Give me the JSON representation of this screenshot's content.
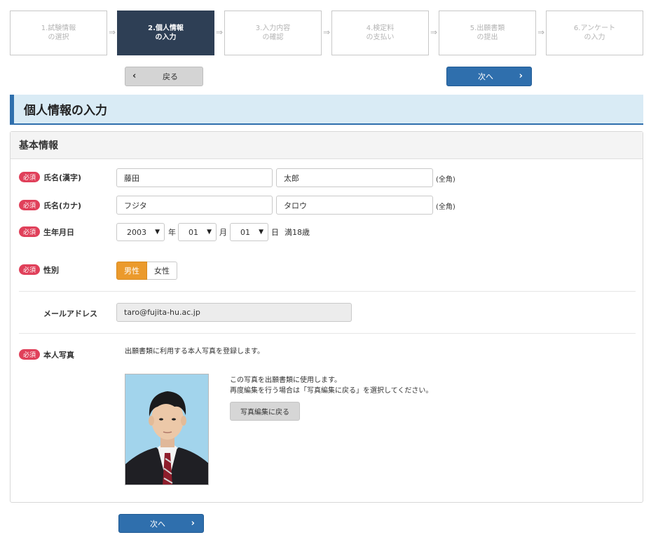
{
  "steps": [
    {
      "label": "1.試験情報\nの選択",
      "active": false
    },
    {
      "label": "2.個人情報\nの入力",
      "active": true
    },
    {
      "label": "3.入力内容\nの確認",
      "active": false
    },
    {
      "label": "4.検定料\nの支払い",
      "active": false
    },
    {
      "label": "5.出願書類\nの提出",
      "active": false
    },
    {
      "label": "6.アンケート\nの入力",
      "active": false
    }
  ],
  "step_arrow": "⇒",
  "nav": {
    "back_label": "戻る",
    "next_label": "次へ"
  },
  "page_title": "個人情報の入力",
  "panel": {
    "title": "基本情報",
    "required_badge": "必須",
    "name_kanji": {
      "label": "氏名(漢字)",
      "last": "藤田",
      "first": "太郎",
      "note": "(全角)"
    },
    "name_kana": {
      "label": "氏名(カナ)",
      "last": "フジタ",
      "first": "タロウ",
      "note": "(全角)"
    },
    "birthdate": {
      "label": "生年月日",
      "year": "2003",
      "year_unit": "年",
      "month": "01",
      "month_unit": "月",
      "day": "01",
      "day_unit": "日",
      "age": "満18歳"
    },
    "gender": {
      "label": "性別",
      "options": [
        "男性",
        "女性"
      ],
      "selected": "男性"
    },
    "email": {
      "label": "メールアドレス",
      "value": "taro@fujita-hu.ac.jp"
    },
    "photo": {
      "label": "本人写真",
      "intro": "出願書類に利用する本人写真を登録します。",
      "info_line1": "この写真を出願書類に使用します。",
      "info_line2": "再度編集を行う場合は「写真編集に戻る」を選択してください。",
      "edit_button": "写真編集に戻る"
    }
  },
  "colors": {
    "accent": "#2f6fad",
    "active_step": "#2e3f55",
    "required": "#e0405a",
    "selected_gender": "#eb9a2c",
    "title_bg": "#d9ebf5"
  }
}
